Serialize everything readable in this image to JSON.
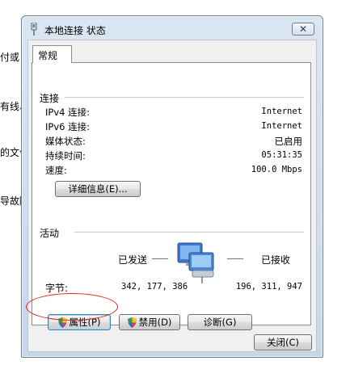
{
  "background": {
    "fragments": [
      "付或 V",
      "有线、",
      "的文作",
      "导故障"
    ]
  },
  "window": {
    "title": "本地连接 状态",
    "close_glyph": "✕"
  },
  "tabs": [
    {
      "label": "常规"
    }
  ],
  "connection": {
    "group_label": "连接",
    "rows": [
      {
        "label": "IPv4 连接:",
        "value": "Internet"
      },
      {
        "label": "IPv6 连接:",
        "value": "Internet"
      },
      {
        "label": "媒体状态:",
        "value": "已启用"
      },
      {
        "label": "持续时间:",
        "value": "05:31:35"
      },
      {
        "label": "速度:",
        "value": "100.0 Mbps"
      }
    ],
    "details_button": "详细信息(E)..."
  },
  "activity": {
    "group_label": "活动",
    "sent_label": "已发送",
    "received_label": "已接收",
    "bytes_label": "字节:",
    "bytes_sent": "342, 177, 386",
    "bytes_received": "196, 311, 947"
  },
  "actions": {
    "properties": "属性(P)",
    "disable": "禁用(D)",
    "diagnose": "诊断(G)"
  },
  "footer": {
    "close": "关闭(C)"
  },
  "colors": {
    "annotation": "#e0241b",
    "title_gradient_top": "#dbe6f3",
    "focus_border": "#3c7fb1"
  }
}
